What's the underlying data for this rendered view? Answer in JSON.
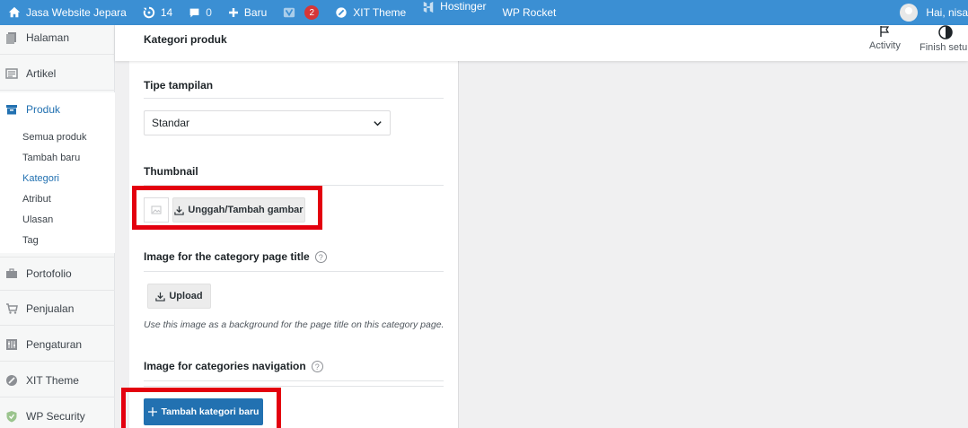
{
  "adminbar": {
    "site_name": "Jasa Website Jepara",
    "updates_count": "14",
    "comments_count": "0",
    "new_label": "Baru",
    "seo_badge": "2",
    "theme_label": "XIT Theme",
    "hosting_label": "Hostinger",
    "rocket_label": "WP Rocket",
    "greeting": "Hai, nisa"
  },
  "sidebar": {
    "items": [
      {
        "label": "Halaman",
        "icon": "pages-icon"
      },
      {
        "label": "Artikel",
        "icon": "posts-icon"
      },
      {
        "label": "Produk",
        "icon": "products-icon"
      },
      {
        "label": "Portofolio",
        "icon": "portfolio-icon"
      },
      {
        "label": "Penjualan",
        "icon": "cart-icon"
      },
      {
        "label": "Pengaturan",
        "icon": "settings-icon"
      },
      {
        "label": "XIT Theme",
        "icon": "xit-theme-icon"
      },
      {
        "label": "WP Security",
        "icon": "shield-icon"
      }
    ],
    "submenu": [
      "Semua produk",
      "Tambah baru",
      "Kategori",
      "Atribut",
      "Ulasan",
      "Tag"
    ],
    "active_submenu": "Kategori"
  },
  "topbar": {
    "title": "Kategori produk",
    "activity_label": "Activity",
    "finish_label": "Finish setup"
  },
  "form": {
    "display_type_label": "Tipe tampilan",
    "display_type_value": "Standar",
    "thumbnail_label": "Thumbnail",
    "thumbnail_button": "Unggah/Tambah gambar",
    "page_title_image_label": "Image for the category page title",
    "upload_button": "Upload",
    "page_title_image_desc": "Use this image as a background for the page title on this category page.",
    "nav_image_label": "Image for categories navigation",
    "help_glyph": "?",
    "submit_button": "Tambah kategori baru"
  },
  "colors": {
    "adminbar": "#3b8fd3",
    "primary": "#2271b1",
    "highlight": "#e3000f",
    "badge": "#d63638"
  }
}
